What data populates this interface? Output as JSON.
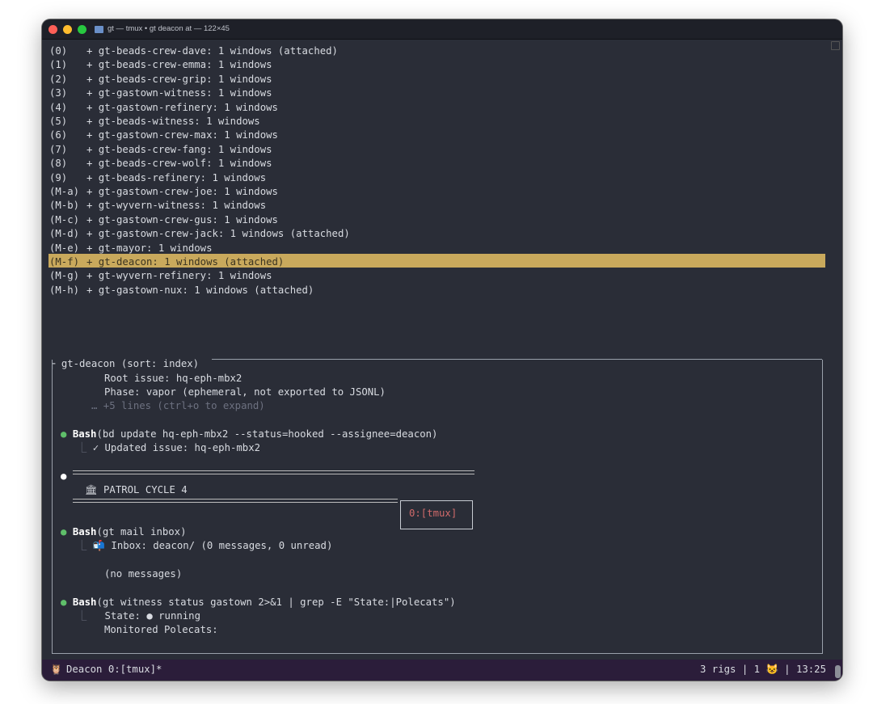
{
  "window": {
    "title": "gt — tmux • gt deacon at — 122×45"
  },
  "sessions": [
    {
      "key": "(0)",
      "text": "+ gt-beads-crew-dave: 1 windows (attached)"
    },
    {
      "key": "(1)",
      "text": "+ gt-beads-crew-emma: 1 windows"
    },
    {
      "key": "(2)",
      "text": "+ gt-beads-crew-grip: 1 windows"
    },
    {
      "key": "(3)",
      "text": "+ gt-gastown-witness: 1 windows"
    },
    {
      "key": "(4)",
      "text": "+ gt-gastown-refinery: 1 windows"
    },
    {
      "key": "(5)",
      "text": "+ gt-beads-witness: 1 windows"
    },
    {
      "key": "(6)",
      "text": "+ gt-gastown-crew-max: 1 windows"
    },
    {
      "key": "(7)",
      "text": "+ gt-beads-crew-fang: 1 windows"
    },
    {
      "key": "(8)",
      "text": "+ gt-beads-crew-wolf: 1 windows"
    },
    {
      "key": "(9)",
      "text": "+ gt-beads-refinery: 1 windows"
    },
    {
      "key": "(M-a)",
      "text": "+ gt-gastown-crew-joe: 1 windows"
    },
    {
      "key": "(M-b)",
      "text": "+ gt-wyvern-witness: 1 windows"
    },
    {
      "key": "(M-c)",
      "text": "+ gt-gastown-crew-gus: 1 windows"
    },
    {
      "key": "(M-d)",
      "text": "+ gt-gastown-crew-jack: 1 windows (attached)"
    },
    {
      "key": "(M-e)",
      "text": "+ gt-mayor: 1 windows"
    },
    {
      "key": "(M-f)",
      "text": "+ gt-deacon: 1 windows (attached)"
    },
    {
      "key": "(M-g)",
      "text": "+ gt-wyvern-refinery: 1 windows"
    },
    {
      "key": "(M-h)",
      "text": "+ gt-gastown-nux: 1 windows (attached)"
    }
  ],
  "selected_index": 15,
  "preview": {
    "header": "gt-deacon (sort: index)",
    "root_issue": "Root issue: hq-eph-mbx2",
    "phase": "Phase: vapor (ephemeral, not exported to JSONL)",
    "more_lines": "… +5 lines (ctrl+o to expand)",
    "cmd1_tool": "Bash",
    "cmd1_args": "(bd update hq-eph-mbx2 --status=hooked --assignee=deacon)",
    "cmd1_result": "✓ Updated issue: hq-eph-mbx2",
    "patrol": "PATROL CYCLE 4",
    "popup_label": "0:[tmux]",
    "cmd2_tool": "Bash",
    "cmd2_args": "(gt mail inbox)",
    "cmd2_result": "Inbox: deacon/ (0 messages, 0 unread)",
    "no_messages": "(no messages)",
    "cmd3_tool": "Bash",
    "cmd3_args": "(gt witness status gastown 2>&1 | grep -E \"State:|Polecats\")",
    "cmd3_state_label": "State:",
    "cmd3_state_value": "running",
    "cmd3_monitored": "Monitored Polecats:"
  },
  "statusbar": {
    "left": "Deacon 0:[tmux]*",
    "rigs": "3 rigs",
    "count": "1",
    "time": "13:25",
    "sep": "|"
  },
  "colors": {
    "terminal_bg": "#2a2d37",
    "highlight": "#c9a95c",
    "statusbar_bg": "#2b1d3a",
    "bullet_green": "#5fbf6a"
  }
}
